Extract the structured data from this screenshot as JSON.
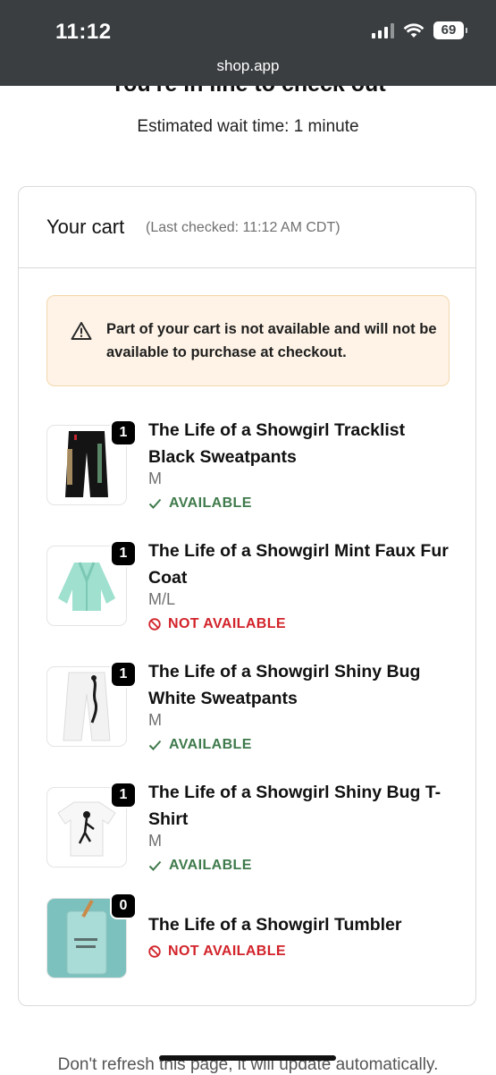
{
  "status_bar": {
    "time": "11:12",
    "battery": "69",
    "url": "shop.app"
  },
  "page": {
    "heading": "You're in line to check out",
    "wait_text": "Estimated wait time: 1 minute",
    "footer_note": "Don't refresh this page, it will update automatically."
  },
  "cart": {
    "title": "Your cart",
    "last_checked": "(Last checked: 11:12 AM CDT)",
    "warning": "Part of your cart is not available and will not be available to purchase at checkout.",
    "items": [
      {
        "name": "The Life of a Showgirl Tracklist Black Sweatpants",
        "variant": "M",
        "quantity": "1",
        "status": "AVAILABLE",
        "image": "black-sweatpants-image"
      },
      {
        "name": "The Life of a Showgirl Mint Faux Fur Coat",
        "variant": "M/L",
        "quantity": "1",
        "status": "NOT AVAILABLE",
        "image": "mint-faux-fur-coat-image"
      },
      {
        "name": "The Life of a Showgirl Shiny Bug White Sweatpants",
        "variant": "M",
        "quantity": "1",
        "status": "AVAILABLE",
        "image": "white-sweatpants-image"
      },
      {
        "name": "The Life of a Showgirl Shiny Bug T-Shirt",
        "variant": "M",
        "quantity": "1",
        "status": "AVAILABLE",
        "image": "white-t-shirt-image"
      },
      {
        "name": "The Life of a Showgirl Tumbler",
        "variant": "",
        "quantity": "0",
        "status": "NOT AVAILABLE",
        "image": "tumbler-image"
      }
    ]
  },
  "colors": {
    "status_bar_bg": "#3a3e40",
    "available": "#3f7a4c",
    "not_available": "#d2232a",
    "warning_bg": "#fef3e6",
    "warning_border": "#f3d8ac"
  },
  "icons": {
    "available": "checkmark-icon",
    "not_available": "prohibited-icon",
    "warning": "warning-triangle-icon"
  }
}
